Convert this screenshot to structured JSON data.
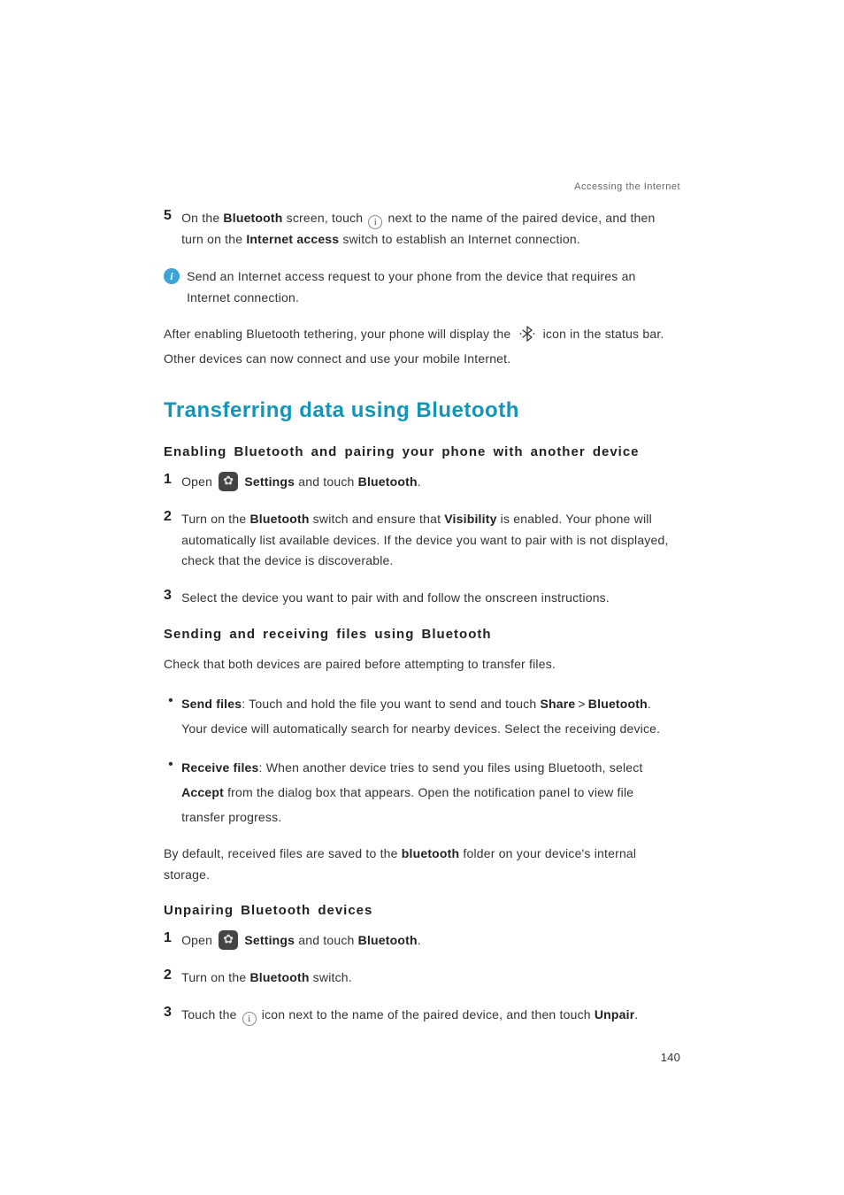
{
  "header": {
    "breadcrumb": "Accessing the Internet"
  },
  "top_step": {
    "num": "5",
    "parts": [
      "On the ",
      "Bluetooth",
      " screen, touch ",
      " next to the name of the paired device, and then turn on the ",
      "Internet access",
      " switch to establish an Internet connection."
    ]
  },
  "top_note": "Send an Internet access request to your phone from the device that requires an Internet connection.",
  "top_after": {
    "parts": [
      "After enabling Bluetooth tethering, your phone will display the ",
      " icon in the status bar. Other devices can now connect and use your mobile Internet."
    ]
  },
  "h1": "Transferring data using Bluetooth",
  "sec1": {
    "title": "Enabling Bluetooth and pairing your phone with another device",
    "steps": [
      {
        "num": "1",
        "parts": [
          "Open ",
          "Settings",
          " and touch ",
          "Bluetooth",
          "."
        ]
      },
      {
        "num": "2",
        "parts": [
          "Turn on the ",
          "Bluetooth",
          " switch and ensure that ",
          "Visibility",
          " is enabled. Your phone will automatically list available devices. If the device you want to pair with is not displayed, check that the device is discoverable."
        ]
      },
      {
        "num": "3",
        "parts": [
          "Select the device you want to pair with and follow the onscreen instructions."
        ]
      }
    ]
  },
  "sec2": {
    "title": "Sending and receiving files using Bluetooth",
    "intro": "Check that both devices are paired before attempting to transfer files.",
    "bullets": [
      {
        "label": "Send files",
        "body": ": Touch and hold the file you want to send and touch ",
        "b1": "Share",
        "gt": ">",
        "b2": "Bluetooth",
        "tail": ". Your device will automatically search for nearby devices. Select the receiving device."
      },
      {
        "label": "Receive files",
        "body": ": When another device tries to send you files using Bluetooth, select ",
        "b1": "Accept",
        "tail": " from the dialog box that appears. Open the notification panel to view file transfer progress."
      }
    ],
    "outro_parts": [
      "By default, received files are saved to the ",
      "bluetooth",
      " folder on your device's internal storage."
    ]
  },
  "sec3": {
    "title": "Unpairing Bluetooth devices",
    "steps": [
      {
        "num": "1",
        "parts": [
          "Open ",
          "Settings",
          " and touch ",
          "Bluetooth",
          "."
        ]
      },
      {
        "num": "2",
        "parts": [
          "Turn on the ",
          "Bluetooth",
          " switch."
        ]
      },
      {
        "num": "3",
        "parts": [
          "Touch the ",
          " icon next to the name of the paired device, and then touch ",
          "Unpair",
          "."
        ]
      }
    ]
  },
  "page_number": "140",
  "glyphs": {
    "info": "i",
    "note": "i",
    "bullet": "•"
  }
}
